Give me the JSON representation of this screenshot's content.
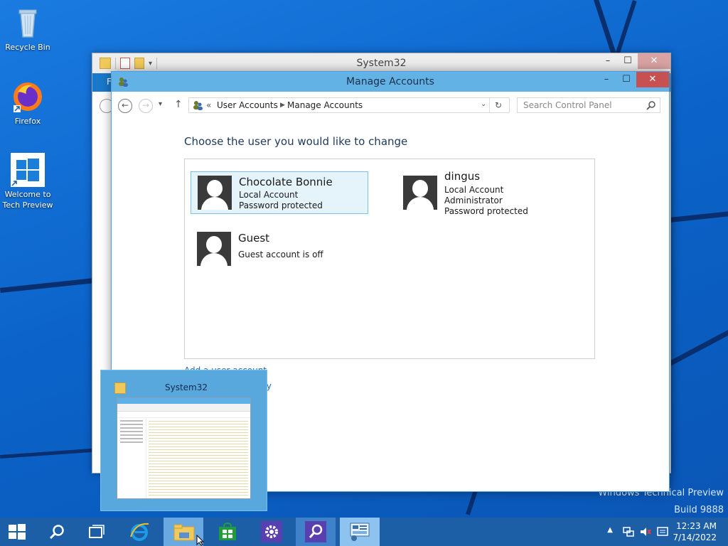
{
  "desktop": {
    "icons": [
      {
        "name": "recycle-bin",
        "label": "Recycle Bin"
      },
      {
        "name": "firefox",
        "label": "Firefox"
      },
      {
        "name": "welcome",
        "label_line1": "Welcome to",
        "label_line2": "Tech Preview"
      }
    ],
    "watermark": {
      "line1": "Windows Technical Preview",
      "line2": "Build 9888"
    }
  },
  "explorer_window": {
    "title": "System32"
  },
  "control_panel": {
    "title": "Manage Accounts",
    "breadcrumb": {
      "prefix": "«",
      "item1": "User Accounts",
      "item2": "Manage Accounts"
    },
    "search_placeholder": "Search Control Panel",
    "heading": "Choose the user you would like to change",
    "users": [
      {
        "name": "Chocolate Bonnie",
        "lines": [
          "Local Account",
          "Password protected"
        ],
        "selected": true
      },
      {
        "name": "dingus",
        "lines": [
          "Local Account",
          "Administrator",
          "Password protected"
        ],
        "selected": false
      },
      {
        "name": "Guest",
        "lines": [
          "Guest account is off"
        ],
        "selected": false
      }
    ],
    "links": {
      "add_user": "Add a user account",
      "partial_link": "ty"
    }
  },
  "thumbnail": {
    "title": "System32"
  },
  "taskbar": {
    "clock": {
      "time": "12:23 AM",
      "date": "7/14/2022"
    }
  },
  "colors": {
    "taskbar": "#1d5fa6",
    "accent": "#63b2e6",
    "link": "#1f69b6"
  }
}
